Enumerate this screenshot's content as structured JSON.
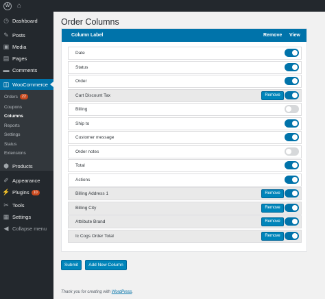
{
  "adminbar": {
    "wp_logo": "W",
    "home_icon": "⌂"
  },
  "sidebar": {
    "items": [
      {
        "label": "Dashboard",
        "icon": "dashboard-icon",
        "glyph": "◷"
      },
      {
        "label": "Posts",
        "icon": "pin-icon",
        "glyph": "✎"
      },
      {
        "label": "Media",
        "icon": "media-icon",
        "glyph": "▣"
      },
      {
        "label": "Pages",
        "icon": "page-icon",
        "glyph": "▤"
      },
      {
        "label": "Comments",
        "icon": "comment-icon",
        "glyph": "▬"
      },
      {
        "label": "WooCommerce",
        "icon": "woo-icon",
        "glyph": "◫"
      },
      {
        "label": "Products",
        "icon": "products-icon",
        "glyph": "⬢"
      },
      {
        "label": "Appearance",
        "icon": "brush-icon",
        "glyph": "✐"
      },
      {
        "label": "Plugins",
        "icon": "plugin-icon",
        "glyph": "⚡",
        "badge": "10"
      },
      {
        "label": "Tools",
        "icon": "wrench-icon",
        "glyph": "✂"
      },
      {
        "label": "Settings",
        "icon": "settings-icon",
        "glyph": "▦"
      },
      {
        "label": "Collapse menu",
        "icon": "collapse-icon",
        "glyph": "◀"
      }
    ],
    "submenu": [
      {
        "label": "Orders",
        "badge": "22"
      },
      {
        "label": "Coupons"
      },
      {
        "label": "Columns"
      },
      {
        "label": "Reports"
      },
      {
        "label": "Settings"
      },
      {
        "label": "Status"
      },
      {
        "label": "Extensions"
      }
    ]
  },
  "main": {
    "title": "Order Columns",
    "table_header": {
      "label": "Column Label",
      "remove": "Remove",
      "view": "View"
    },
    "rows": [
      {
        "label": "Date",
        "custom": false,
        "enabled": true
      },
      {
        "label": "Status",
        "custom": false,
        "enabled": true
      },
      {
        "label": "Order",
        "custom": false,
        "enabled": true
      },
      {
        "label": "Cart Discount Tax",
        "custom": true,
        "enabled": true
      },
      {
        "label": "Billing",
        "custom": false,
        "enabled": false
      },
      {
        "label": "Ship to",
        "custom": false,
        "enabled": true
      },
      {
        "label": "Customer message",
        "custom": false,
        "enabled": true
      },
      {
        "label": "Order notes",
        "custom": false,
        "enabled": false
      },
      {
        "label": "Total",
        "custom": false,
        "enabled": true
      },
      {
        "label": "Actions",
        "custom": false,
        "enabled": true
      },
      {
        "label": "Billing Address 1",
        "custom": true,
        "enabled": true
      },
      {
        "label": "Billing City",
        "custom": true,
        "enabled": true
      },
      {
        "label": "Attribute Brand",
        "custom": true,
        "enabled": true
      },
      {
        "label": "Ic Cogs Order Total",
        "custom": true,
        "enabled": true
      }
    ],
    "remove_label": "Remove",
    "submit_label": "Submit",
    "add_column_label": "Add New Column"
  },
  "footer": {
    "text": "Thank you for creating with ",
    "link": "WordPress",
    "end": "."
  },
  "colors": {
    "accent": "#0073aa",
    "sidebar": "#23282d",
    "badge": "#ca4a1f"
  }
}
